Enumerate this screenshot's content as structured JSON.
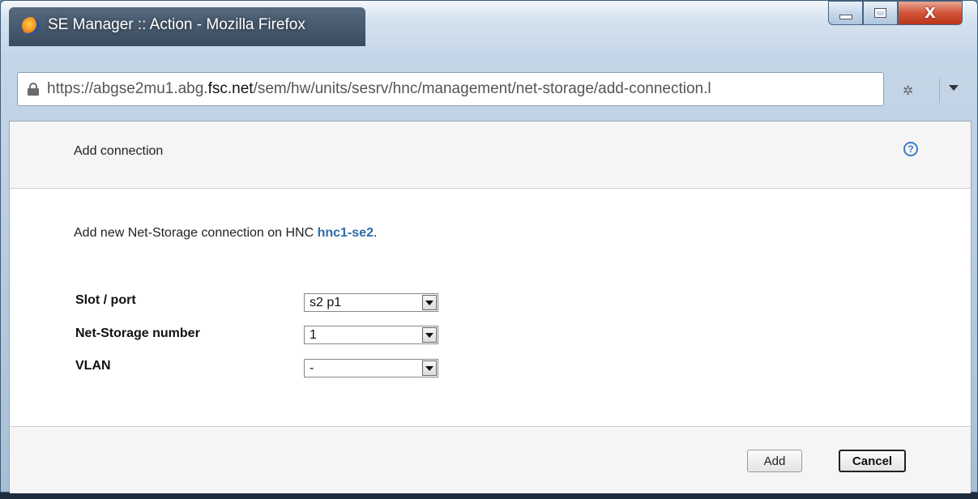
{
  "window": {
    "title": "SE Manager :: Action - Mozilla Firefox",
    "close_glyph": "X"
  },
  "urlbar": {
    "url_prefix": "https://abgse2mu1.abg.",
    "url_host": "fsc.net",
    "url_suffix": "/sem/hw/units/sesrv/hnc/management/net-storage/add-connection.l"
  },
  "dialog": {
    "title": "Add connection",
    "help_glyph": "?",
    "intro_text": "Add new Net-Storage connection on HNC ",
    "intro_host": "hnc1-se2",
    "intro_end": ".",
    "fields": [
      {
        "label": "Slot / port",
        "value": "s2 p1"
      },
      {
        "label": "Net-Storage number",
        "value": "1"
      },
      {
        "label": "VLAN",
        "value": "-"
      }
    ],
    "buttons": {
      "add": "Add",
      "cancel": "Cancel"
    }
  },
  "icons": {
    "app": "firefox-icon",
    "lock": "lock-icon",
    "addon": "bug-icon",
    "help": "help-icon",
    "dropdown": "chevron-down-icon"
  }
}
